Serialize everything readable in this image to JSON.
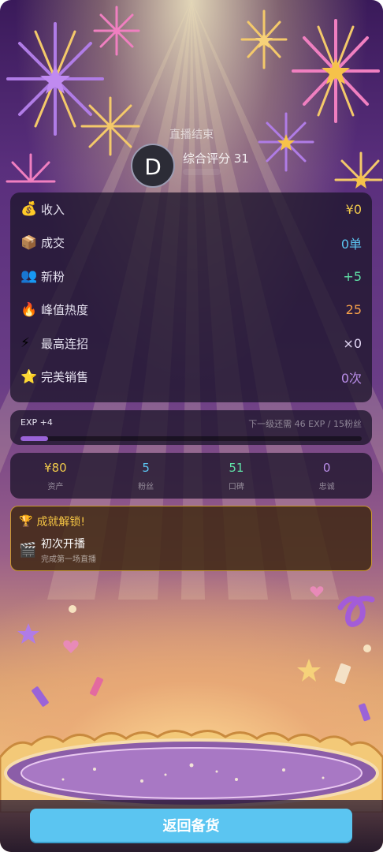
{
  "header": {
    "subtitle": "直播结束",
    "avatar_letter": "D",
    "score_text": "综合评分 31"
  },
  "stats": [
    {
      "icon": "money-bag-icon",
      "glyph": "💰",
      "label": "收入",
      "value": "¥0",
      "color": "#f0c94a"
    },
    {
      "icon": "package-icon",
      "glyph": "📦",
      "label": "成交",
      "value": "0单",
      "color": "#5bc5f1"
    },
    {
      "icon": "people-icon",
      "glyph": "👥",
      "label": "新粉",
      "value": "+5",
      "color": "#5fe0a6"
    },
    {
      "icon": "fire-icon",
      "glyph": "🔥",
      "label": "峰值热度",
      "value": "25",
      "color": "#f5a04a"
    },
    {
      "icon": "lightning-icon",
      "glyph": "⚡",
      "label": "最高连招",
      "value": "×0",
      "color": "#e4d8f5"
    },
    {
      "icon": "star-icon",
      "glyph": "⭐",
      "label": "完美销售",
      "value": "0次",
      "color": "#b98de8"
    }
  ],
  "exp": {
    "gain_label": "EXP +4",
    "next_level_text": "下一级还需 46 EXP / 15粉丝",
    "progress": 0.08
  },
  "resources": [
    {
      "value": "¥80",
      "label": "资产",
      "color": "#f0c94a"
    },
    {
      "value": "5",
      "label": "粉丝",
      "color": "#5bc5f1"
    },
    {
      "value": "51",
      "label": "口碑",
      "color": "#5fe0a6"
    },
    {
      "value": "0",
      "label": "忠诚",
      "color": "#b98de8"
    }
  ],
  "achievement": {
    "header_icon": "trophy-icon",
    "header_glyph": "🏆",
    "title": "成就解锁!",
    "item_icon": "clapperboard-icon",
    "item_glyph": "🎬",
    "name": "初次开播",
    "description": "完成第一场直播"
  },
  "footer": {
    "button_label": "返回备货"
  },
  "colors": {
    "accent_blue": "#5bc5f1",
    "gold": "#f0c94a",
    "achievement_border": "#c9982e"
  }
}
